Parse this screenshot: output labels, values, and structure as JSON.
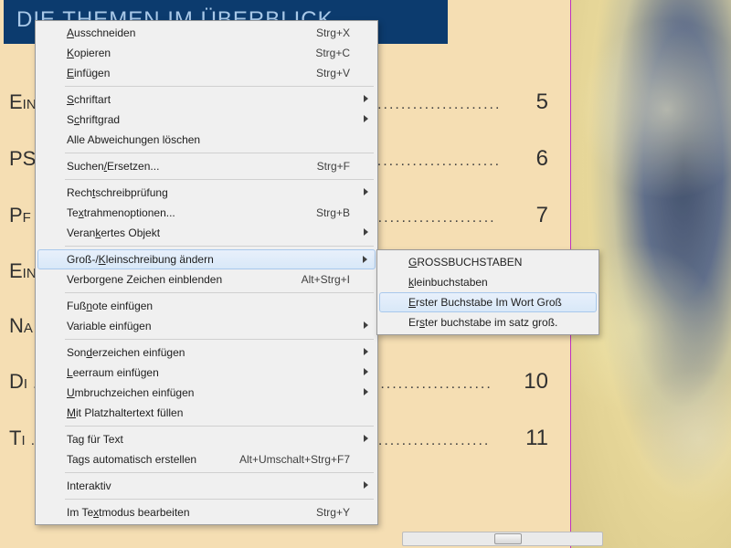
{
  "title_bar": "DIE THEMEN IM ÜBERBLICK",
  "toc": [
    {
      "label": "Ein",
      "page": "5"
    },
    {
      "label": "PS",
      "page": "6"
    },
    {
      "label": "Pf",
      "page": "7"
    },
    {
      "label": "Ein",
      "page": ""
    },
    {
      "label": "Na",
      "page": ""
    },
    {
      "label": "Di",
      "page": "10"
    },
    {
      "label": "Ti",
      "page": "11"
    }
  ],
  "menu": {
    "cut": {
      "label": "Ausschneiden",
      "ul": "A",
      "shortcut": "Strg+X"
    },
    "copy": {
      "label": "Kopieren",
      "ul": "K",
      "shortcut": "Strg+C"
    },
    "paste": {
      "label": "Einfügen",
      "ul": "E",
      "shortcut": "Strg+V"
    },
    "font": {
      "label": "Schriftart",
      "ul": "S"
    },
    "fontsize": {
      "label": "Schriftgrad",
      "ul": "c"
    },
    "clear_overrides": {
      "label": "Alle Abweichungen löschen"
    },
    "findreplace": {
      "label": "Suchen/Ersetzen...",
      "ul": "/",
      "shortcut": "Strg+F"
    },
    "spellcheck": {
      "label": "Rechtschreibprüfung",
      "ul": "t"
    },
    "frame_options": {
      "label": "Textrahmenoptionen...",
      "ul": "x",
      "shortcut": "Strg+B"
    },
    "anchored": {
      "label": "Verankertes Objekt",
      "ul": "k"
    },
    "change_case": {
      "label": "Groß-/Kleinschreibung ändern",
      "ul": "K"
    },
    "show_hidden": {
      "label": "Verborgene Zeichen einblenden",
      "shortcut": "Alt+Strg+I"
    },
    "footnote": {
      "label": "Fußnote einfügen",
      "ul": "n"
    },
    "variable": {
      "label": "Variable einfügen"
    },
    "special_char": {
      "label": "Sonderzeichen einfügen",
      "ul": "d"
    },
    "whitespace": {
      "label": "Leerraum einfügen",
      "ul": "L"
    },
    "break_char": {
      "label": "Umbruchzeichen einfügen",
      "ul": "U"
    },
    "placeholder": {
      "label": "Mit Platzhaltertext füllen",
      "ul": "M"
    },
    "tag_for_text": {
      "label": "Tag für Text"
    },
    "autotag": {
      "label": "Tags automatisch erstellen",
      "shortcut": "Alt+Umschalt+Strg+F7"
    },
    "interactive": {
      "label": "Interaktiv"
    },
    "story_editor": {
      "label": "Im Textmodus bearbeiten",
      "ul": "x",
      "shortcut": "Strg+Y"
    }
  },
  "submenu": {
    "upper": {
      "label": "GROSSBUCHSTABEN",
      "ul": "G"
    },
    "lower": {
      "label": "kleinbuchstaben",
      "ul": "k"
    },
    "title_case": {
      "label": "Erster Buchstabe Im Wort Groß",
      "ul": "E"
    },
    "sentence": {
      "label": "Erster buchstabe im satz groß.",
      "ul": "s"
    }
  }
}
